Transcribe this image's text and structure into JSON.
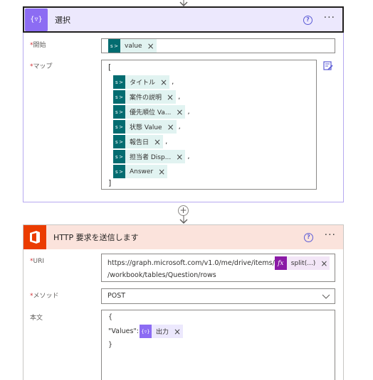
{
  "select_action": {
    "title": "選択",
    "from_label": "開始",
    "from_token": "value",
    "map_label": "マップ",
    "map_open": "[",
    "map_close": "]",
    "map_items": [
      {
        "label": "タイトル",
        "comma": ","
      },
      {
        "label": "案件の説明",
        "comma": ","
      },
      {
        "label": "優先順位 Va...",
        "comma": ","
      },
      {
        "label": "状態 Value",
        "comma": ","
      },
      {
        "label": "報告日",
        "comma": ","
      },
      {
        "label": "担当者 Disp...",
        "comma": ","
      },
      {
        "label": "Answer",
        "comma": ""
      }
    ]
  },
  "http_action": {
    "title": "HTTP 要求を送信します",
    "uri_label": "URI",
    "uri_text1": "https://graph.microsoft.com/v1.0/me/drive/items/",
    "uri_fx_token": "split(...)",
    "uri_text2": "/workbook/tables/Question/rows",
    "method_label": "メソッド",
    "method_value": "POST",
    "body_label": "本文",
    "body_open": "{",
    "body_key": "\"Values\":",
    "body_token": "出力",
    "body_close": "}"
  },
  "required_marker": "*",
  "help_glyph": "?",
  "more_glyph": "···",
  "close_glyph": "×",
  "add_glyph": "+",
  "sp_icon_glyph": "s >",
  "fx_icon_glyph": "fx",
  "var_icon_glyph": "{▿}",
  "select_icon_glyph": "{▿}",
  "colors": {
    "select_accent": "#8c6cf3",
    "office_accent": "#eb3c00",
    "sharepoint_accent": "#036c70",
    "expression_accent": "#8a1aa6"
  }
}
